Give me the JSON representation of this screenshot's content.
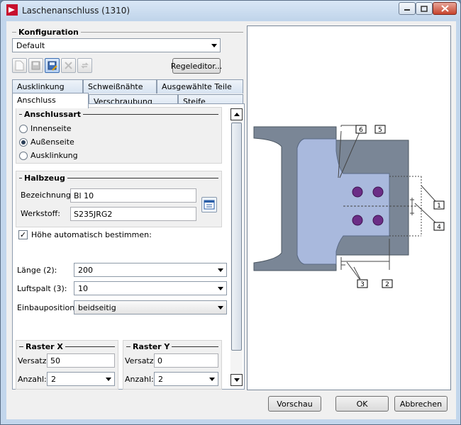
{
  "window": {
    "title": "Laschenanschluss (1310)"
  },
  "konfiguration": {
    "title": "Konfiguration",
    "selected": "Default",
    "regeleditor_label": "Regeleditor..."
  },
  "tabs_row1": [
    "Ausklinkung",
    "Schweißnähte",
    "Ausgewählte Teile"
  ],
  "tabs_row2": [
    "Anschluss",
    "Verschraubung",
    "Steife"
  ],
  "anschlussart": {
    "title": "Anschlussart",
    "options": [
      "Innenseite",
      "Außenseite",
      "Ausklinkung"
    ],
    "selected_index": 1
  },
  "halbzeug": {
    "title": "Halbzeug",
    "bezeichnung_label": "Bezeichnung:",
    "bezeichnung_value": "Bl 10",
    "werkstoff_label": "Werkstoff:",
    "werkstoff_value": "S235JRG2"
  },
  "hoehe_auto": {
    "label": "Höhe automatisch bestimmen:",
    "checked": true
  },
  "laenge": {
    "label": "Länge (2):",
    "value": "200"
  },
  "luftspalt": {
    "label": "Luftspalt (3):",
    "value": "10"
  },
  "einbauposition": {
    "label": "Einbauposition:",
    "value": "beidseitig"
  },
  "raster_x": {
    "title": "Raster X",
    "versatz_label": "Versatz:",
    "versatz_value": "50",
    "anzahl_label": "Anzahl:",
    "anzahl_value": "2"
  },
  "raster_y": {
    "title": "Raster Y",
    "versatz_label": "Versatz:",
    "versatz_value": "0",
    "anzahl_label": "Anzahl:",
    "anzahl_value": "2"
  },
  "preview_labels": {
    "l1": "1",
    "l2": "2",
    "l3": "3",
    "l4": "4",
    "l5": "5",
    "l6": "6"
  },
  "buttons": {
    "vorschau": "Vorschau",
    "ok": "OK",
    "abbrechen": "Abbrechen"
  },
  "colors": {
    "steel": "#7a8696",
    "plate": "#a9b9dd",
    "bolt": "#6b2d86",
    "active_radio": "#2a3e57"
  }
}
